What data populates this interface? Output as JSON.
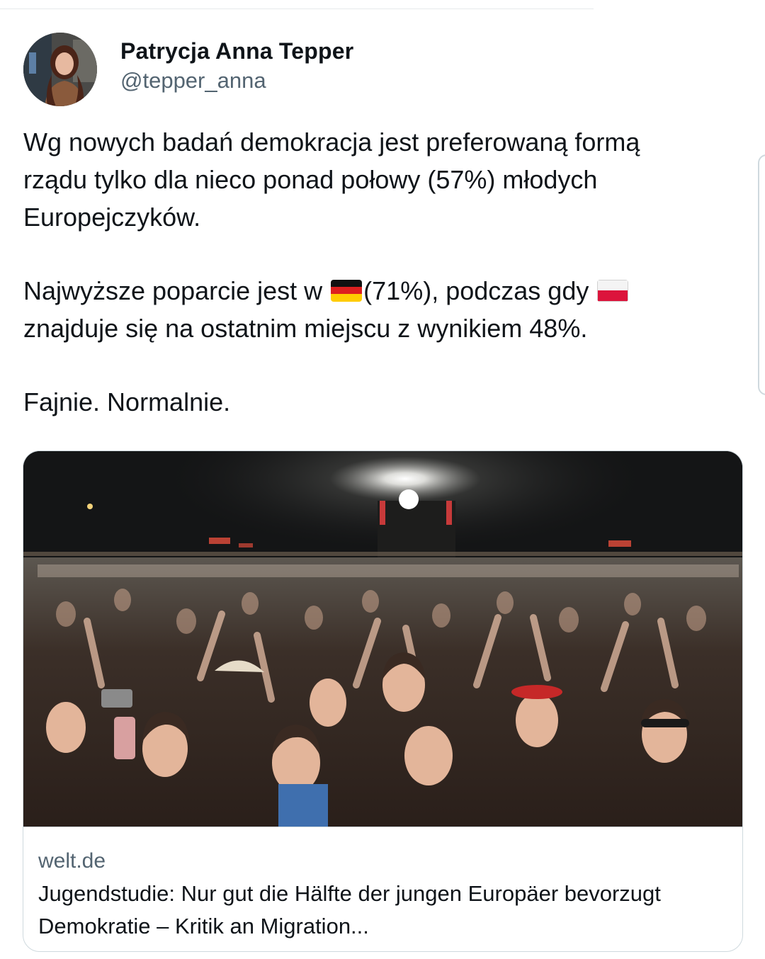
{
  "tweet": {
    "author": {
      "display_name": "Patrycja Anna Tepper",
      "handle": "@tepper_anna"
    },
    "text": {
      "line1": "Wg nowych badań demokracja jest preferowaną formą",
      "line2": "rządu tylko dla nieco ponad połowy (57%) młodych",
      "line3": "Europejczyków.",
      "line4_before_flag": "Najwyższe poparcie jest w ",
      "line4_flag1": "germany-flag-icon",
      "line4_middle": "(71%), podczas gdy ",
      "line4_flag2": "poland-flag-icon",
      "line5": "znajduje się na ostatnim miejscu z wynikiem 48%.",
      "line6": "Fajnie. Normalnie."
    },
    "link_card": {
      "domain": "welt.de",
      "title_line1": "Jugendstudie: Nur gut die Hälfte der jungen Europäer bevorzugt",
      "title_line2": "Demokratie – Kritik an Migration..."
    }
  },
  "colors": {
    "text": "#0f1419",
    "secondary": "#536471",
    "border": "#cfd9de"
  }
}
